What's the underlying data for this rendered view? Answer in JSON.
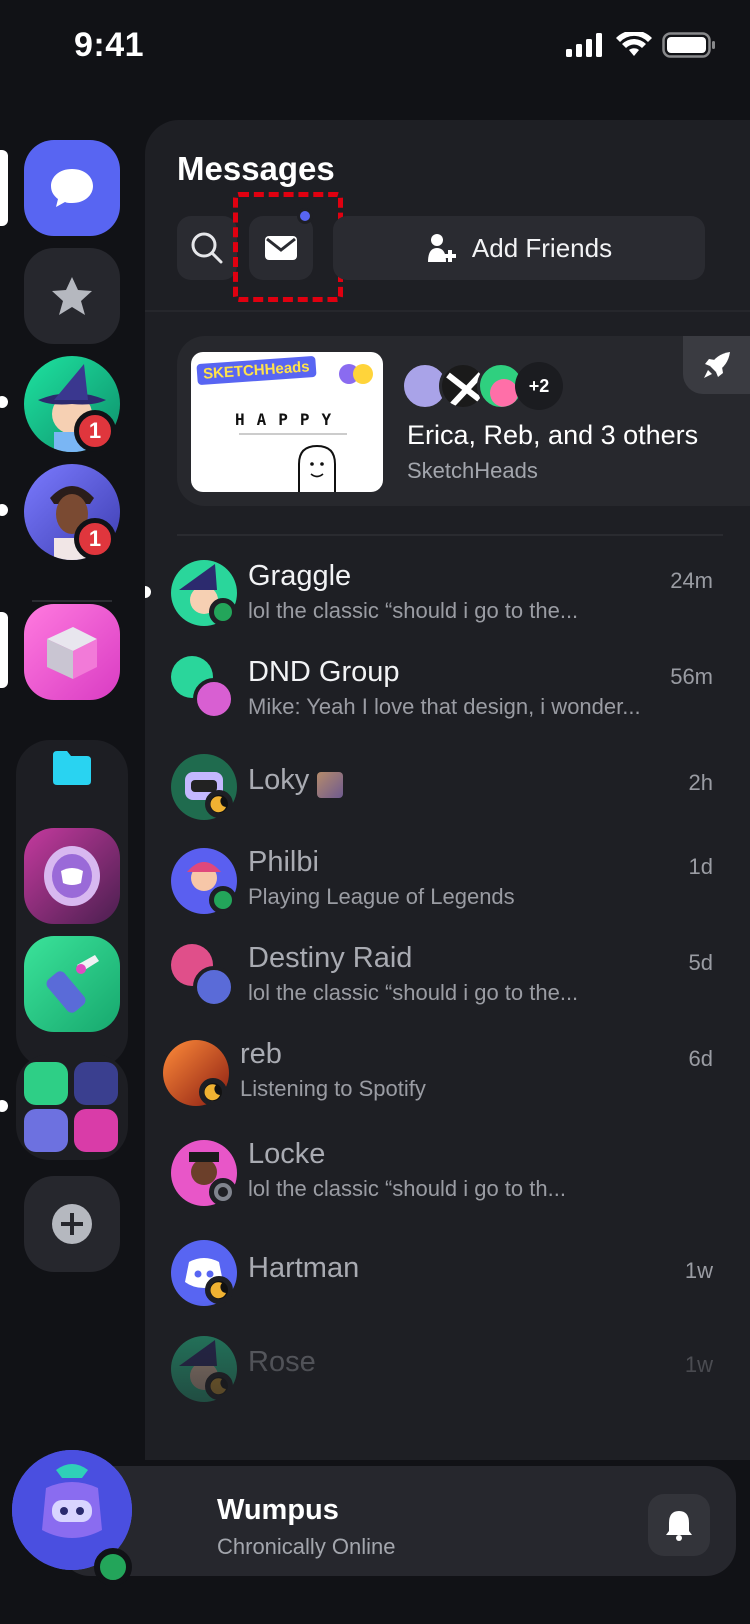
{
  "status_bar": {
    "time": "9:41"
  },
  "colors": {
    "blurple": "#5865f2",
    "online": "#23a55a",
    "idle": "#f0b232",
    "badge": "#e0363d",
    "highlight": "#e00010"
  },
  "rail": {
    "servers": [
      {
        "name": "direct-messages",
        "icon": "chat-bubble-icon"
      },
      {
        "name": "favorites",
        "icon": "star-icon"
      },
      {
        "name": "user-dm-1",
        "badge": "1"
      },
      {
        "name": "user-dm-2",
        "badge": "1"
      }
    ],
    "add_server_icon": "plus-icon"
  },
  "messages": {
    "title": "Messages",
    "search_icon": "search-icon",
    "inbox_icon": "envelope-icon",
    "add_friends_label": "Add Friends"
  },
  "featured": {
    "thumb_brand": "SKETCHHeads",
    "thumb_word": "HAPPY",
    "extra_count": "+2",
    "title": "Erica, Reb, and 3 others",
    "subtitle": "SketchHeads"
  },
  "conversations": [
    {
      "name": "Graggle",
      "preview": "lol the classic “should i go to the...",
      "time": "24m",
      "status": "online"
    },
    {
      "name": "DND Group",
      "preview": "Mike: Yeah I love that design, i wonder...",
      "time": "56m",
      "status": "group"
    },
    {
      "name": "Loky",
      "preview": "",
      "time": "2h",
      "status": "idle"
    },
    {
      "name": "Philbi",
      "preview": "Playing League of Legends",
      "time": "1d",
      "status": "online"
    },
    {
      "name": "Destiny Raid",
      "preview": "lol the classic “should i go to the...",
      "time": "5d",
      "status": "group"
    },
    {
      "name": "reb",
      "preview": "Listening to Spotify",
      "time": "6d",
      "status": "idle"
    },
    {
      "name": "Locke",
      "preview": "lol the classic “should i go to th...",
      "time": "",
      "status": "offline"
    },
    {
      "name": "Hartman",
      "preview": "",
      "time": "1w",
      "status": "idle"
    },
    {
      "name": "Rose",
      "preview": "",
      "time": "1w",
      "status": "idle"
    }
  ],
  "user": {
    "name": "Wumpus",
    "status": "Chronically Online",
    "bell_icon": "bell-icon"
  }
}
